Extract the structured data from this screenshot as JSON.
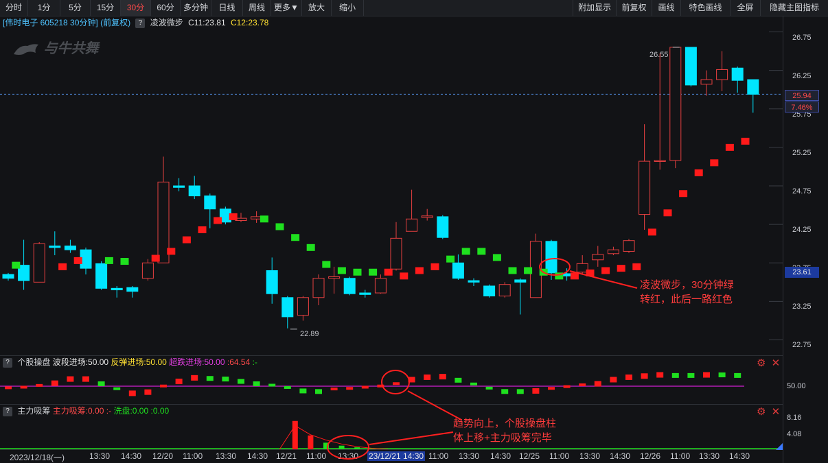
{
  "toolbar": {
    "left": [
      "分时",
      "1分",
      "5分",
      "15分",
      "30分",
      "60分",
      "多分钟",
      "日线",
      "周线",
      "更多▼",
      "放大",
      "缩小"
    ],
    "right": [
      "附加显示",
      "前复权",
      "画线",
      "特色画线",
      "全屏",
      "隐藏主图指标"
    ],
    "active": "30分"
  },
  "header": {
    "stock": "[伟时电子 605218 30分钟]",
    "adjust": "(前复权)",
    "indicator_name": "凌波微步",
    "c1": "C11:23.81",
    "c2": "C12:23.78"
  },
  "watermark": "与牛共舞",
  "price_axis": [
    "26.75",
    "26.25",
    "25.75",
    "25.25",
    "24.75",
    "24.25",
    "23.75",
    "23.25",
    "22.75"
  ],
  "badges": {
    "price": "25.94",
    "pct": "7.46%",
    "level": "23.61"
  },
  "marks": {
    "high": "26.55",
    "low": "22.89"
  },
  "annotations": {
    "a1_line1": "凌波微步，30分钟绿",
    "a1_line2": "转红，此后一路红色",
    "a2_line1": "趋势向上，个股操盘柱",
    "a2_line2": "体上移+主力吸筹完毕"
  },
  "ind1": {
    "name": "个股操盘",
    "f1": "波段进场:50.00",
    "f2": "反弹进场:50.00",
    "f3": "超跌进场:50.00",
    "f4": ":64.54",
    "f5": ":-",
    "axis": "50.00"
  },
  "ind2": {
    "name": "主力吸筹",
    "f1": "主力吸筹:0.00",
    "f2": ":-",
    "f3": "洗盘:0.00",
    "f4": ":0.00",
    "axis_top": "8.16",
    "axis_mid": "4.08"
  },
  "dates": [
    "2023/12/18(一)",
    "13:30",
    "14:30",
    "12/20",
    "11:00",
    "13:30",
    "14:30",
    "12/21",
    "11:00",
    "13:30",
    "23/12/21 14:30",
    "11:00",
    "13:30",
    "14:30",
    "12/25",
    "11:00",
    "13:30",
    "14:30",
    "12/26",
    "11:00",
    "13:30",
    "14:30"
  ],
  "colors": {
    "up": "#e84040",
    "down": "#00e5ff",
    "green": "#1fe01f",
    "red": "#ff1a1a",
    "magenta": "#d21ed2"
  },
  "chart_data": {
    "type": "candlestick",
    "y_range": [
      22.55,
      26.95
    ],
    "candles": [
      {
        "o": 23.6,
        "c": 23.55,
        "h": 23.62,
        "l": 23.52
      },
      {
        "o": 23.72,
        "c": 23.52,
        "h": 24.05,
        "l": 23.4
      },
      {
        "o": 23.5,
        "c": 24.0,
        "h": 24.02,
        "l": 23.5
      },
      {
        "o": 23.97,
        "c": 23.95,
        "h": 24.16,
        "l": 23.85
      },
      {
        "o": 23.97,
        "c": 23.92,
        "h": 24.05,
        "l": 23.88
      },
      {
        "o": 23.92,
        "c": 23.68,
        "h": 23.95,
        "l": 23.6
      },
      {
        "o": 23.74,
        "c": 23.42,
        "h": 23.77,
        "l": 23.4
      },
      {
        "o": 23.42,
        "c": 23.4,
        "h": 23.45,
        "l": 23.3
      },
      {
        "o": 23.43,
        "c": 23.38,
        "h": 23.45,
        "l": 23.3
      },
      {
        "o": 23.55,
        "c": 23.75,
        "h": 23.8,
        "l": 23.52
      },
      {
        "o": 23.75,
        "c": 24.8,
        "h": 25.13,
        "l": 23.75
      },
      {
        "o": 24.75,
        "c": 24.73,
        "h": 24.85,
        "l": 24.68
      },
      {
        "o": 24.75,
        "c": 24.62,
        "h": 24.88,
        "l": 24.58
      },
      {
        "o": 24.62,
        "c": 24.45,
        "h": 24.65,
        "l": 24.2
      },
      {
        "o": 24.45,
        "c": 24.28,
        "h": 24.48,
        "l": 24.25
      },
      {
        "o": 24.3,
        "c": 24.33,
        "h": 24.4,
        "l": 24.28
      },
      {
        "o": 24.32,
        "c": 24.35,
        "h": 24.42,
        "l": 24.27
      },
      {
        "o": 23.65,
        "c": 23.35,
        "h": 23.82,
        "l": 23.22
      },
      {
        "o": 23.3,
        "c": 23.05,
        "h": 23.32,
        "l": 22.9
      },
      {
        "o": 23.07,
        "c": 23.3,
        "h": 23.32,
        "l": 23.0
      },
      {
        "o": 23.3,
        "c": 23.55,
        "h": 23.6,
        "l": 23.2
      },
      {
        "o": 23.55,
        "c": 23.57,
        "h": 23.7,
        "l": 23.35
      },
      {
        "o": 23.55,
        "c": 23.35,
        "h": 23.57,
        "l": 23.33
      },
      {
        "o": 23.36,
        "c": 23.34,
        "h": 23.4,
        "l": 23.3
      },
      {
        "o": 23.36,
        "c": 23.55,
        "h": 23.6,
        "l": 23.35
      },
      {
        "o": 23.67,
        "c": 24.07,
        "h": 24.28,
        "l": 23.65
      },
      {
        "o": 24.16,
        "c": 24.32,
        "h": 24.7,
        "l": 24.16
      },
      {
        "o": 24.34,
        "c": 24.36,
        "h": 24.45,
        "l": 24.3
      },
      {
        "o": 24.35,
        "c": 24.08,
        "h": 24.37,
        "l": 24.06
      },
      {
        "o": 23.75,
        "c": 23.55,
        "h": 23.86,
        "l": 23.53
      },
      {
        "o": 23.52,
        "c": 23.5,
        "h": 23.55,
        "l": 23.45
      },
      {
        "o": 23.45,
        "c": 23.32,
        "h": 23.47,
        "l": 23.3
      },
      {
        "o": 23.32,
        "c": 23.47,
        "h": 23.5,
        "l": 23.3
      },
      {
        "o": 23.53,
        "c": 23.5,
        "h": 23.55,
        "l": 23.08
      },
      {
        "o": 23.3,
        "c": 24.03,
        "h": 24.13,
        "l": 23.3
      },
      {
        "o": 24.03,
        "c": 23.62,
        "h": 24.05,
        "l": 23.53
      },
      {
        "o": 23.61,
        "c": 23.58,
        "h": 23.68,
        "l": 23.52
      },
      {
        "o": 23.63,
        "c": 23.74,
        "h": 23.85,
        "l": 23.6
      },
      {
        "o": 23.79,
        "c": 23.86,
        "h": 23.97,
        "l": 23.7
      },
      {
        "o": 23.87,
        "c": 23.92,
        "h": 23.96,
        "l": 23.85
      },
      {
        "o": 23.9,
        "c": 24.04,
        "h": 24.06,
        "l": 23.88
      },
      {
        "o": 24.38,
        "c": 25.07,
        "h": 25.55,
        "l": 24.18
      },
      {
        "o": 25.07,
        "c": 25.08,
        "h": 26.47,
        "l": 24.96
      },
      {
        "o": 25.08,
        "c": 26.55,
        "h": 26.55,
        "l": 24.98
      },
      {
        "o": 26.55,
        "c": 26.06,
        "h": 26.55,
        "l": 26.04
      },
      {
        "o": 26.07,
        "c": 26.13,
        "h": 26.25,
        "l": 25.92
      },
      {
        "o": 26.13,
        "c": 26.26,
        "h": 26.5,
        "l": 25.98
      },
      {
        "o": 26.28,
        "c": 26.12,
        "h": 26.3,
        "l": 25.96
      },
      {
        "o": 26.13,
        "c": 25.94,
        "h": 26.13,
        "l": 25.7
      }
    ],
    "signal_line": [
      {
        "i": 0,
        "v": 23.72,
        "c": "green"
      },
      {
        "i": 3,
        "v": 23.7,
        "c": "red"
      },
      {
        "i": 4,
        "v": 23.78,
        "c": "red"
      },
      {
        "i": 6,
        "v": 23.78,
        "c": "green"
      },
      {
        "i": 7,
        "v": 23.77,
        "c": "green"
      },
      {
        "i": 9,
        "v": 23.81,
        "c": "red"
      },
      {
        "i": 10,
        "v": 23.9,
        "c": "red"
      },
      {
        "i": 11,
        "v": 24.05,
        "c": "red"
      },
      {
        "i": 12,
        "v": 24.18,
        "c": "red"
      },
      {
        "i": 13,
        "v": 24.3,
        "c": "red"
      },
      {
        "i": 14,
        "v": 24.35,
        "c": "red"
      },
      {
        "i": 16,
        "v": 24.32,
        "c": "green"
      },
      {
        "i": 17,
        "v": 24.22,
        "c": "green"
      },
      {
        "i": 18,
        "v": 24.08,
        "c": "green"
      },
      {
        "i": 19,
        "v": 23.95,
        "c": "green"
      },
      {
        "i": 20,
        "v": 23.73,
        "c": "green"
      },
      {
        "i": 21,
        "v": 23.65,
        "c": "green"
      },
      {
        "i": 22,
        "v": 23.63,
        "c": "green"
      },
      {
        "i": 23,
        "v": 23.63,
        "c": "green"
      },
      {
        "i": 24,
        "v": 23.63,
        "c": "red"
      },
      {
        "i": 25,
        "v": 23.58,
        "c": "red"
      },
      {
        "i": 26,
        "v": 23.65,
        "c": "red"
      },
      {
        "i": 27,
        "v": 23.7,
        "c": "red"
      },
      {
        "i": 28,
        "v": 23.8,
        "c": "green"
      },
      {
        "i": 29,
        "v": 23.9,
        "c": "green"
      },
      {
        "i": 30,
        "v": 23.9,
        "c": "green"
      },
      {
        "i": 31,
        "v": 23.82,
        "c": "green"
      },
      {
        "i": 32,
        "v": 23.65,
        "c": "green"
      },
      {
        "i": 33,
        "v": 23.65,
        "c": "green"
      },
      {
        "i": 34,
        "v": 23.63,
        "c": "green"
      },
      {
        "i": 35,
        "v": 23.58,
        "c": "green"
      },
      {
        "i": 36,
        "v": 23.58,
        "c": "red"
      },
      {
        "i": 37,
        "v": 23.62,
        "c": "red"
      },
      {
        "i": 38,
        "v": 23.65,
        "c": "red"
      },
      {
        "i": 39,
        "v": 23.68,
        "c": "red"
      },
      {
        "i": 40,
        "v": 23.7,
        "c": "red"
      },
      {
        "i": 41,
        "v": 24.15,
        "c": "red"
      },
      {
        "i": 42,
        "v": 24.4,
        "c": "red"
      },
      {
        "i": 43,
        "v": 24.65,
        "c": "red"
      },
      {
        "i": 44,
        "v": 24.92,
        "c": "red"
      },
      {
        "i": 45,
        "v": 25.05,
        "c": "red"
      },
      {
        "i": 46,
        "v": 25.25,
        "c": "red"
      },
      {
        "i": 47,
        "v": 25.33,
        "c": "red"
      }
    ],
    "ind1_range": [
      20,
      80
    ],
    "ind1_bars": [
      {
        "i": 0,
        "v": 45,
        "c": "red"
      },
      {
        "i": 1,
        "v": 46,
        "c": "red"
      },
      {
        "i": 2,
        "v": 49,
        "c": "red"
      },
      {
        "i": 3,
        "v": 55,
        "c": "red"
      },
      {
        "i": 4,
        "v": 62,
        "c": "red"
      },
      {
        "i": 5,
        "v": 62,
        "c": "red"
      },
      {
        "i": 6,
        "v": 54,
        "c": "green"
      },
      {
        "i": 7,
        "v": 44,
        "c": "green"
      },
      {
        "i": 8,
        "v": 38,
        "c": "red"
      },
      {
        "i": 9,
        "v": 40,
        "c": "red"
      },
      {
        "i": 10,
        "v": 48,
        "c": "red"
      },
      {
        "i": 11,
        "v": 58,
        "c": "red"
      },
      {
        "i": 12,
        "v": 64,
        "c": "red"
      },
      {
        "i": 13,
        "v": 63,
        "c": "green"
      },
      {
        "i": 14,
        "v": 62,
        "c": "green"
      },
      {
        "i": 15,
        "v": 58,
        "c": "green"
      },
      {
        "i": 16,
        "v": 54,
        "c": "green"
      },
      {
        "i": 17,
        "v": 50,
        "c": "green"
      },
      {
        "i": 18,
        "v": 46,
        "c": "green"
      },
      {
        "i": 19,
        "v": 42,
        "c": "green"
      },
      {
        "i": 20,
        "v": 41,
        "c": "green"
      },
      {
        "i": 21,
        "v": 43,
        "c": "red"
      },
      {
        "i": 22,
        "v": 44,
        "c": "red"
      },
      {
        "i": 23,
        "v": 46,
        "c": "red"
      },
      {
        "i": 24,
        "v": 48,
        "c": "red"
      },
      {
        "i": 25,
        "v": 52,
        "c": "red"
      },
      {
        "i": 26,
        "v": 61,
        "c": "red"
      },
      {
        "i": 27,
        "v": 65,
        "c": "red"
      },
      {
        "i": 28,
        "v": 66,
        "c": "red"
      },
      {
        "i": 29,
        "v": 60,
        "c": "green"
      },
      {
        "i": 30,
        "v": 52,
        "c": "green"
      },
      {
        "i": 31,
        "v": 45,
        "c": "green"
      },
      {
        "i": 32,
        "v": 41,
        "c": "green"
      },
      {
        "i": 33,
        "v": 41,
        "c": "green"
      },
      {
        "i": 34,
        "v": 42,
        "c": "red"
      },
      {
        "i": 35,
        "v": 44,
        "c": "red"
      },
      {
        "i": 36,
        "v": 47,
        "c": "red"
      },
      {
        "i": 37,
        "v": 50,
        "c": "red"
      },
      {
        "i": 38,
        "v": 54,
        "c": "red"
      },
      {
        "i": 39,
        "v": 61,
        "c": "red"
      },
      {
        "i": 40,
        "v": 65,
        "c": "red"
      },
      {
        "i": 41,
        "v": 67,
        "c": "red"
      },
      {
        "i": 42,
        "v": 69,
        "c": "red"
      },
      {
        "i": 43,
        "v": 68,
        "c": "green"
      },
      {
        "i": 44,
        "v": 68,
        "c": "green"
      },
      {
        "i": 45,
        "v": 69,
        "c": "red"
      },
      {
        "i": 46,
        "v": 69,
        "c": "green"
      },
      {
        "i": 47,
        "v": 68,
        "c": "green"
      }
    ],
    "ind2_range": [
      0,
      10
    ],
    "ind2_bars": [
      {
        "i": 18,
        "v": 8.6,
        "c": "red"
      },
      {
        "i": 19,
        "v": 4.2,
        "c": "red"
      },
      {
        "i": 20,
        "v": 2.0,
        "c": "green"
      },
      {
        "i": 21,
        "v": 1.1,
        "c": "green"
      },
      {
        "i": 22,
        "v": 0.6,
        "c": "green"
      },
      {
        "i": 23,
        "v": 0.3,
        "c": "green"
      }
    ],
    "ind2_line": [
      {
        "i": 17,
        "v": 0
      },
      {
        "i": 18,
        "v": 7.2
      },
      {
        "i": 19,
        "v": 4.4
      },
      {
        "i": 20,
        "v": 2.8
      },
      {
        "i": 21,
        "v": 1.6
      },
      {
        "i": 22,
        "v": 0.8
      },
      {
        "i": 23,
        "v": 0.3
      },
      {
        "i": 24,
        "v": 0
      }
    ]
  }
}
